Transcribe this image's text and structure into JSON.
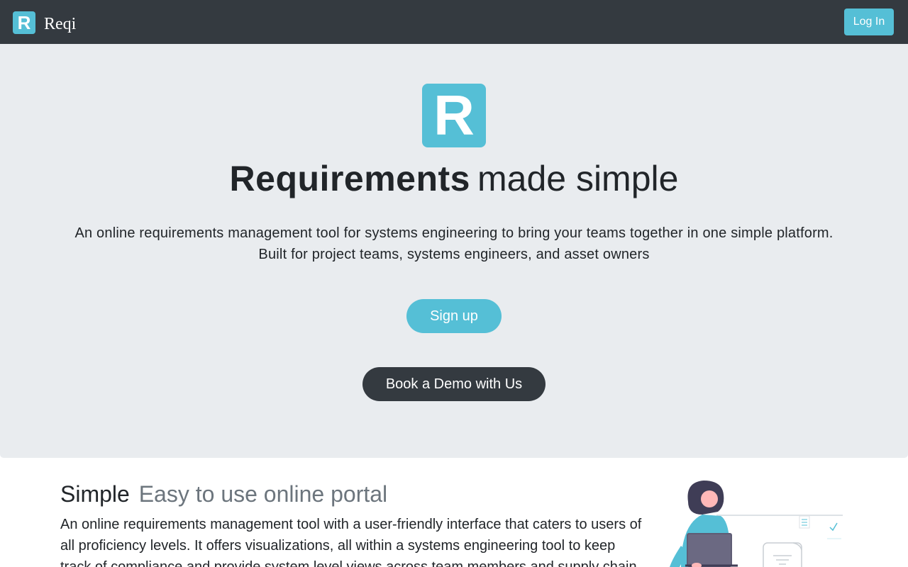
{
  "navbar": {
    "logo_letter": "R",
    "brand_name": "Reqi",
    "login_label": "Log In"
  },
  "hero": {
    "logo_letter": "R",
    "title_bold": "Requirements",
    "title_light": "made simple",
    "description_line1": "An online requirements management tool for systems engineering to bring your teams together in one simple platform.",
    "description_line2": "Built for project teams, systems engineers, and asset owners",
    "signup_label": "Sign up",
    "demo_label": "Book a Demo with Us"
  },
  "feature": {
    "heading_main": "Simple",
    "heading_muted": "Easy to use online portal",
    "text": "An online requirements management tool with a user-friendly interface that caters to users of all proficiency levels. It offers visualizations, all within a systems engineering tool to keep track of compliance and provide system level views across team members and supply chain."
  },
  "colors": {
    "brand_accent": "#55bfd6",
    "navbar_bg": "#343a40",
    "hero_bg": "#e9ecef",
    "muted_text": "#6c757d"
  }
}
